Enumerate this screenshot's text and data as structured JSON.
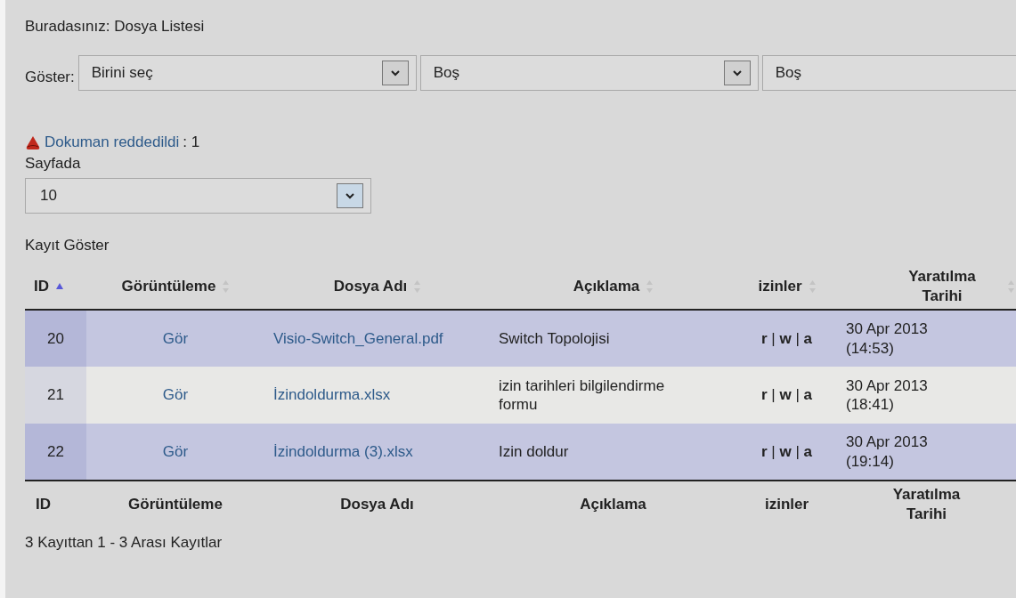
{
  "breadcrumb": "Buradasınız: Dosya Listesi",
  "filter": {
    "label": "Göster:",
    "selects": [
      {
        "value": "Birini seç"
      },
      {
        "value": "Boş"
      },
      {
        "value": "Boş"
      }
    ]
  },
  "notice": {
    "link": "Dokuman reddedildi",
    "count": ": 1"
  },
  "page_size": {
    "label": "Sayfada",
    "value": "10"
  },
  "show_records": "Kayıt Göster",
  "table": {
    "columns": [
      {
        "label": "ID",
        "sorted": true
      },
      {
        "label": "Görüntüleme",
        "sorted": false
      },
      {
        "label": "Dosya Adı",
        "sorted": false
      },
      {
        "label": "Açıklama",
        "sorted": false
      },
      {
        "label": "izinler",
        "sorted": false
      },
      {
        "label": "Yaratılma Tarihi",
        "sorted": false
      }
    ],
    "rows": [
      {
        "id": "20",
        "view": "Gör",
        "file_name": "Visio-Switch_General.pdf",
        "description": "Switch Topolojisi",
        "permissions": "**r** | **w** | **a**",
        "created": "30 Apr 2013 (14:53)"
      },
      {
        "id": "21",
        "view": "Gör",
        "file_name": "İzindoldurma.xlsx",
        "description": "izin tarihleri bilgilendirme formu",
        "permissions": "**r** | **w** | **a**",
        "created": "30 Apr 2013 (18:41)"
      },
      {
        "id": "22",
        "view": "Gör",
        "file_name": "İzindoldurma (3).xlsx",
        "description": "Izin doldur",
        "permissions": "**r** | **w** | **a**",
        "created": "30 Apr 2013 (19:14)"
      }
    ],
    "footer": [
      "ID",
      "Görüntüleme",
      "Dosya Adı",
      "Açıklama",
      "izinler",
      "Yaratılma Tarihi"
    ]
  },
  "info": "3 Kayıttan 1 - 3 Arası Kayıtlar"
}
